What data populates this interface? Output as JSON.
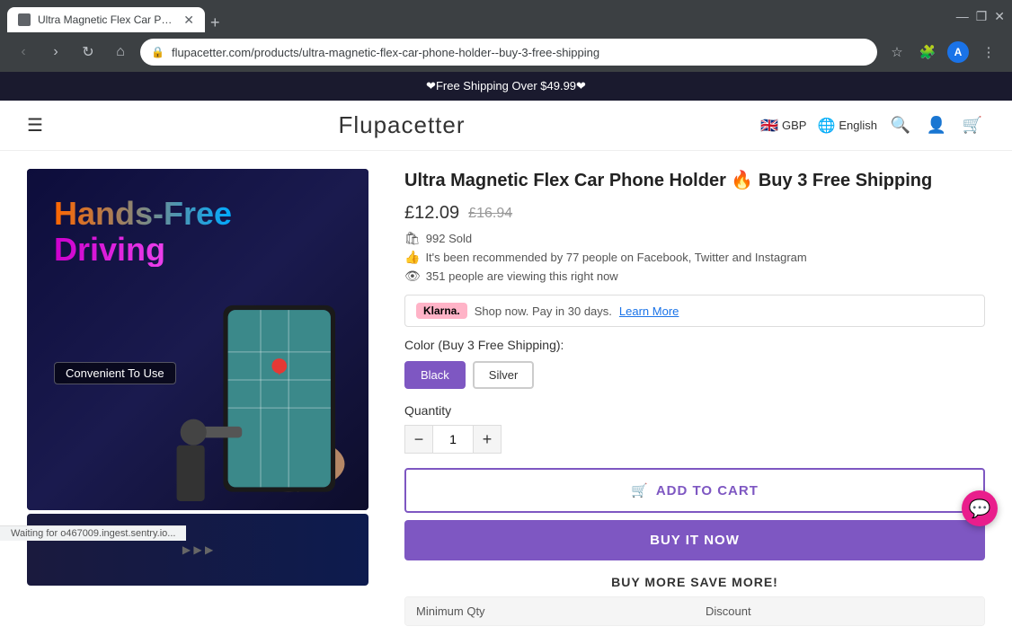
{
  "browser": {
    "tab_title": "Ultra Magnetic Flex Car Phone",
    "url": "flupacetter.com/products/ultra-magnetic-flex-car-phone-holder--buy-3-free-shipping",
    "nav_buttons": [
      "back",
      "forward",
      "reload",
      "home"
    ]
  },
  "announcement": {
    "text": "❤Free Shipping Over $49.99❤"
  },
  "header": {
    "logo": "Flupacetter",
    "currency": "GBP",
    "language": "English",
    "menu_icon": "☰"
  },
  "product": {
    "title": "Ultra Magnetic Flex Car Phone Holder 🔥 Buy 3 Free Shipping",
    "price_current": "£12.09",
    "price_original": "£16.94",
    "sold_count": "992 Sold",
    "recommended_text": "It's been recommended by 77 people on Facebook, Twitter and Instagram",
    "viewing_text": "351 people are viewing this right now",
    "klarna_text": "Shop now. Pay in 30 days.",
    "klarna_link": "Learn More",
    "color_label": "Color (Buy 3 Free Shipping):",
    "colors": [
      {
        "name": "Black",
        "active": true
      },
      {
        "name": "Silver",
        "active": false
      }
    ],
    "quantity_label": "Quantity",
    "quantity_value": "1",
    "add_to_cart_label": "ADD TO CART",
    "buy_now_label": "BUY IT NOW",
    "buy_more_label": "BUY MORE SAVE MORE!",
    "table_headers": [
      "Minimum Qty",
      "Discount"
    ]
  },
  "image": {
    "headline1": "Hands-Free",
    "headline2": "Driving",
    "badge": "Convenient To Use"
  },
  "status_bar": {
    "text": "Waiting for o467009.ingest.sentry.io..."
  },
  "icons": {
    "cart": "🛒",
    "search": "🔍",
    "user": "👤",
    "globe": "🌐",
    "menu": "☰",
    "chat": "💬",
    "sold": "🛍",
    "recommended": "👍",
    "viewing": "👁",
    "fire": "🔥"
  }
}
